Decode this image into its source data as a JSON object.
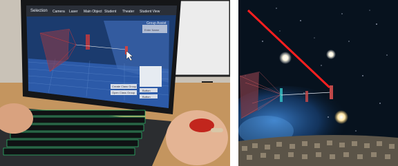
{
  "left_photo": {
    "laptop_screen": {
      "menu": [
        "Selection",
        "Camera",
        "Laser",
        "Main Object",
        "Student",
        "Theater",
        "Student View"
      ],
      "panel_title": "Group Assist",
      "panel_field": "Enter Name",
      "buttons": [
        "Create Class Group",
        "Open Class Group"
      ],
      "side_buttons": [
        "Button",
        "Button"
      ]
    },
    "keyboard_backlight_color": "#29e07a",
    "mouse_color": "#c2261d"
  },
  "right_photo": {
    "laser_color": "#ff1f1f",
    "nebula_color": "#2f74c8",
    "stars": "bright"
  }
}
